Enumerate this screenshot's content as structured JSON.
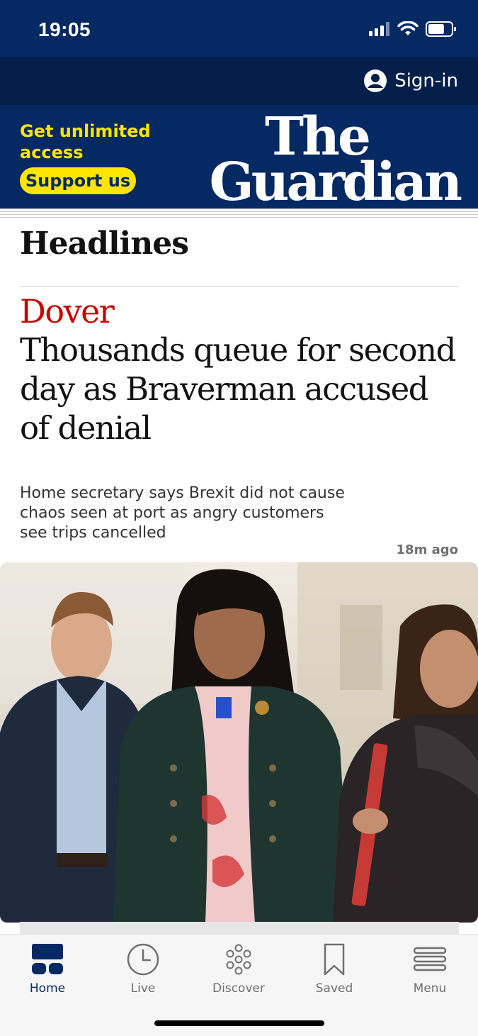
{
  "status_bar": {
    "time": "19:05"
  },
  "account": {
    "signin_label": "Sign-in"
  },
  "masthead": {
    "promo_text": "Get unlimited access",
    "support_label": "Support us",
    "logo_line1": "The",
    "logo_line2": "Guardian"
  },
  "section": {
    "title": "Headlines"
  },
  "lead_story": {
    "kicker": "Dover",
    "headline": "Thousands queue for second day as Braverman accused of denial",
    "standfirst": "Home secretary says Brexit did not cause chaos seen at port as angry customers see trips cancelled",
    "timestamp": "18m ago"
  },
  "bottom_nav": {
    "items": [
      {
        "label": "Home",
        "icon": "home-icon",
        "active": true
      },
      {
        "label": "Live",
        "icon": "clock-icon",
        "active": false
      },
      {
        "label": "Discover",
        "icon": "discover-icon",
        "active": false
      },
      {
        "label": "Saved",
        "icon": "bookmark-icon",
        "active": false
      },
      {
        "label": "Menu",
        "icon": "menu-icon",
        "active": false
      }
    ]
  },
  "colors": {
    "brand_blue": "#052962",
    "accent_yellow": "#ffe500",
    "kicker_red": "#c70000"
  }
}
